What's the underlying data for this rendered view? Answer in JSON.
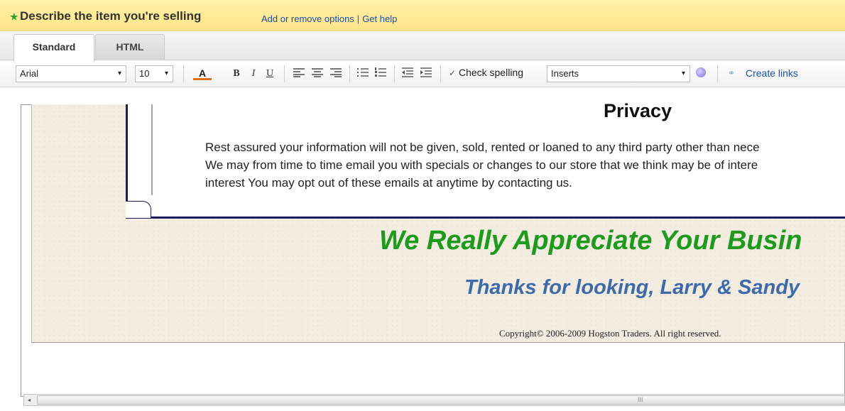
{
  "header": {
    "title": "Describe the item you're selling",
    "links": [
      "Add or remove options",
      "Get help"
    ],
    "separator": "|"
  },
  "tabs": [
    {
      "label": "Standard",
      "active": true
    },
    {
      "label": "HTML",
      "active": false
    }
  ],
  "toolbar": {
    "font": "Arial",
    "size": "10",
    "bold": "B",
    "italic": "I",
    "underline": "U",
    "font_color": "A",
    "check_spelling": "Check spelling",
    "inserts": "Inserts",
    "create_links": "Create links",
    "dropdown_glyph": "▾"
  },
  "content": {
    "privacy_title": "Privacy",
    "privacy_lines": [
      "Rest assured your information will not be given, sold, rented or loaned to any third party other than nece",
      "We may from time to time email you with specials or changes to our store that we think may be of intere",
      "interest You may opt out of these emails at anytime by contacting us."
    ],
    "appreciate": "We Really Appreciate Your Busin",
    "thanks": "Thanks for looking, Larry & Sandy",
    "copyright": "Copyright© 2006-2009 Hogston Traders. All right reserved."
  },
  "scrollbar": {
    "left_arrow": "◂",
    "grip": "III"
  },
  "colors": {
    "header_bg": "#fde48a",
    "link": "#1a4fa8",
    "appreciate": "#1e9a1e",
    "thanks": "#3d6aa8",
    "border_navy": "#1b1d5e"
  },
  "icons": [
    "star-icon",
    "font-color-icon",
    "align-left-icon",
    "align-center-icon",
    "align-right-icon",
    "bullet-list-icon",
    "numbered-list-icon",
    "outdent-icon",
    "indent-icon",
    "spellcheck-icon",
    "help-icon",
    "link-icon"
  ]
}
